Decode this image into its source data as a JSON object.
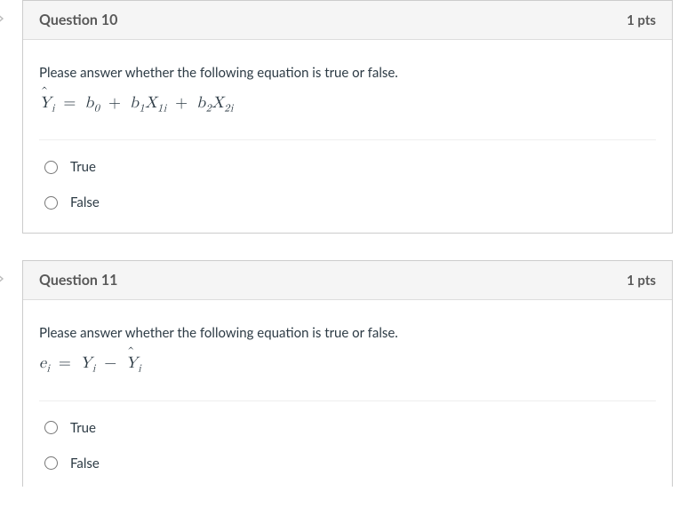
{
  "questions": [
    {
      "title": "Question 10",
      "pts": "1 pts",
      "prompt": "Please answer whether the following equation is true or false.",
      "equation_html": "<span class='hat'>Y</span><span class='sub'>i</span> <span class='op'>=</span> b<span class='sub'>0</span> <span class='op'>+</span> b<span class='sub'>1</span>X<span class='sub'>1i</span> <span class='op'>+</span> b<span class='sub'>2</span>X<span class='sub'>2i</span>",
      "options": [
        {
          "label": "True"
        },
        {
          "label": "False"
        }
      ]
    },
    {
      "title": "Question 11",
      "pts": "1 pts",
      "prompt": "Please answer whether the following equation is true or false.",
      "equation_html": "e<span class='sub'>i</span> <span class='op'>=</span> Y<span class='sub'>i</span> <span class='op'>&minus;</span> <span class='hat'>Y</span><span class='sub'>i</span>",
      "options": [
        {
          "label": "True"
        },
        {
          "label": "False"
        }
      ]
    }
  ]
}
